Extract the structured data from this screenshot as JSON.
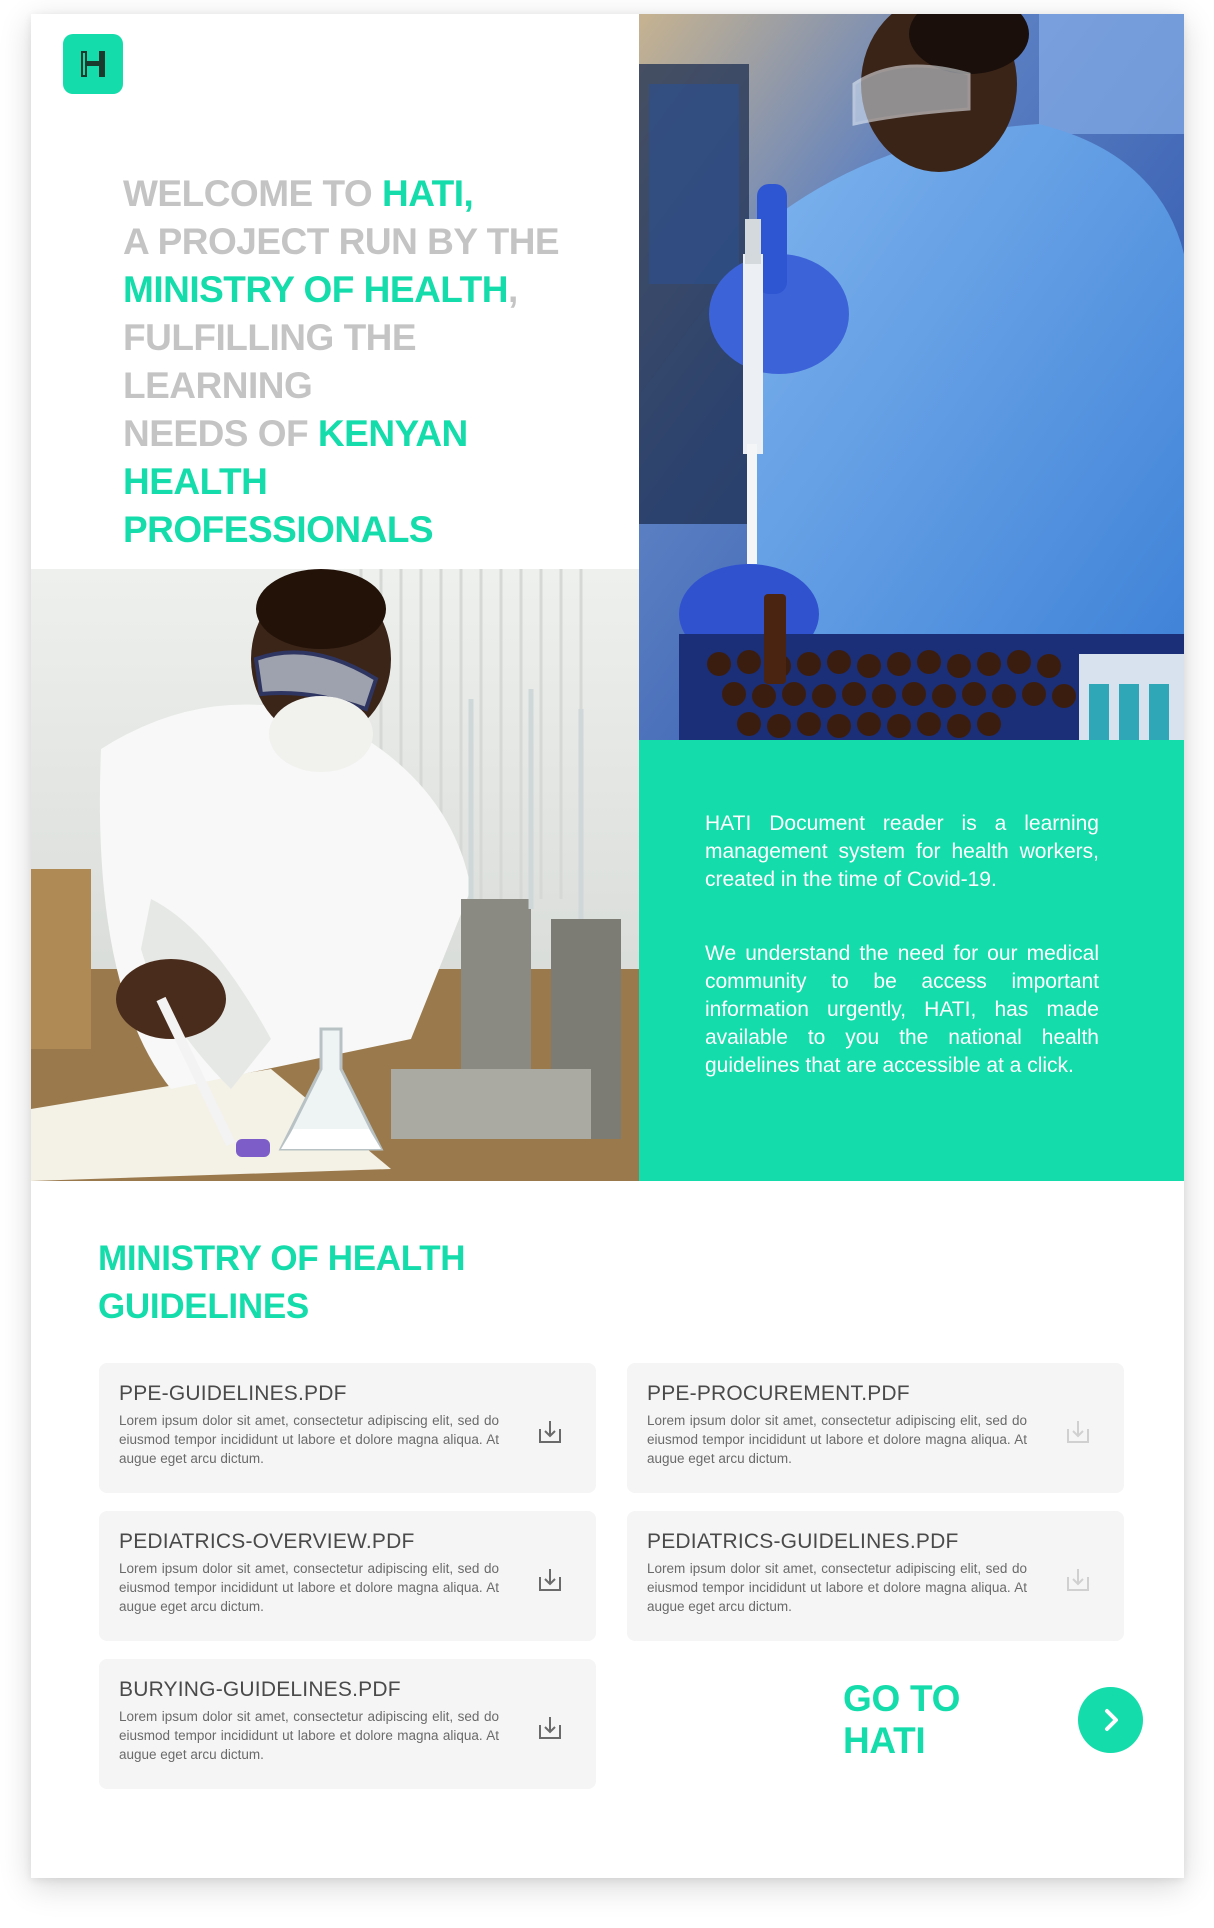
{
  "brand": {
    "logo_letter": "H",
    "accent": "#14dcaa"
  },
  "hero": {
    "l1a": "WELCOME TO ",
    "l1b": "HATI,",
    "l2": "A PROJECT RUN BY THE",
    "l3a": "MINISTRY OF HEALTH",
    "l3b": ",",
    "l4": "FULFILLING THE LEARNING",
    "l5a": "NEEDS OF ",
    "l5b": "KENYAN HEALTH",
    "l6": "PROFESSIONALS"
  },
  "info": {
    "p1": "HATI Document reader is a learning management system for health workers, created in the time of Covid-19.",
    "p2": "We understand the need for our medical community to be access important information urgently, HATI, has made available to you the national health guidelines that are accessible at a click."
  },
  "guidelines": {
    "title_line1": "MINISTRY OF HEALTH",
    "title_line2": "GUIDELINES",
    "docs": [
      {
        "name": "PPE-GUIDELINES.PDF",
        "desc": "Lorem ipsum dolor sit amet, consectetur adipiscing elit, sed do eiusmod tempor incididunt ut labore et dolore magna aliqua. At augue eget arcu dictum."
      },
      {
        "name": "PPE-PROCUREMENT.PDF",
        "desc": "Lorem ipsum dolor sit amet, consectetur adipiscing elit, sed do eiusmod tempor incididunt ut labore et dolore magna aliqua. At augue eget arcu dictum."
      },
      {
        "name": "PEDIATRICS-OVERVIEW.PDF",
        "desc": "Lorem ipsum dolor sit amet, consectetur adipiscing elit, sed do eiusmod tempor incididunt ut labore et dolore magna aliqua. At augue eget arcu dictum."
      },
      {
        "name": "PEDIATRICS-GUIDELINES.PDF",
        "desc": "Lorem ipsum dolor sit amet, consectetur adipiscing elit, sed do eiusmod tempor incididunt ut labore et dolore magna aliqua. At augue eget arcu dictum."
      },
      {
        "name": "BURYING-GUIDELINES.PDF",
        "desc": "Lorem ipsum dolor sit amet, consectetur adipiscing elit, sed do eiusmod tempor incididunt ut labore et dolore magna aliqua. At augue eget arcu dictum."
      }
    ]
  },
  "cta": {
    "label": "GO TO HATI",
    "icon": "chevron-right-icon"
  }
}
